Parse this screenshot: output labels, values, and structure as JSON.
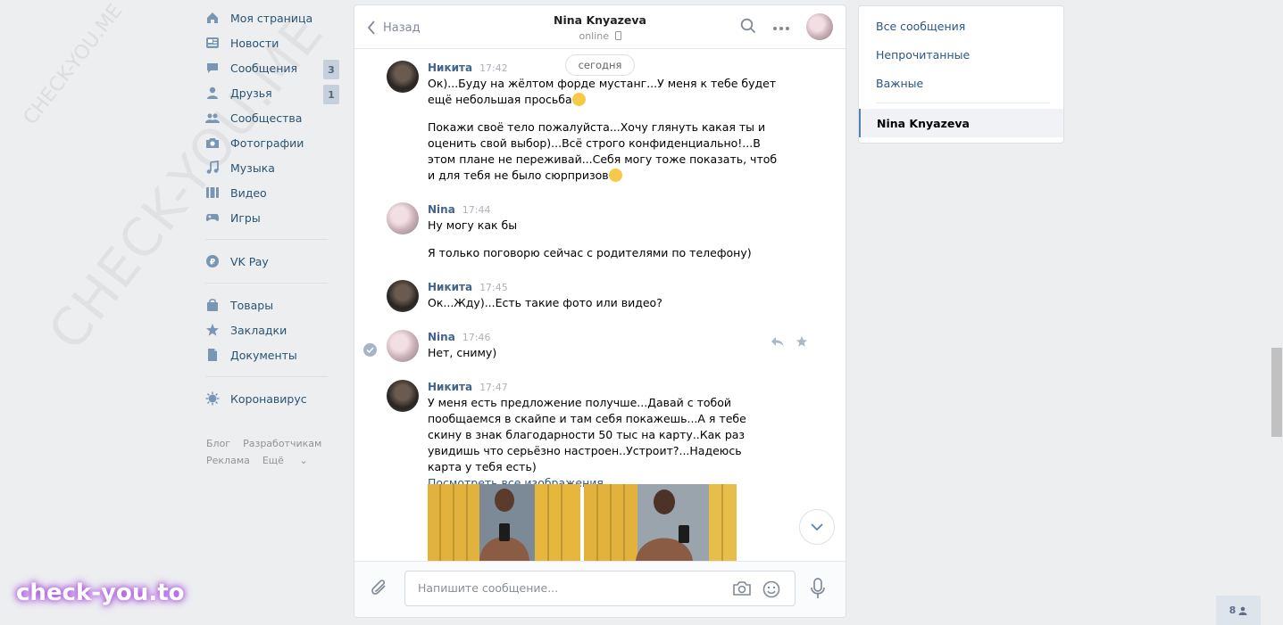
{
  "watermark": {
    "big": "CHECK-YOU.ME",
    "small": "CHECK-YOU.ME",
    "brand": "check-you.to"
  },
  "nav": {
    "items": [
      {
        "label": "Моя страница",
        "icon": "home-icon"
      },
      {
        "label": "Новости",
        "icon": "news-icon"
      },
      {
        "label": "Сообщения",
        "icon": "message-icon",
        "badge": "3"
      },
      {
        "label": "Друзья",
        "icon": "friends-icon",
        "badge": "1"
      },
      {
        "label": "Сообщества",
        "icon": "groups-icon"
      },
      {
        "label": "Фотографии",
        "icon": "camera-icon"
      },
      {
        "label": "Музыка",
        "icon": "music-icon"
      },
      {
        "label": "Видео",
        "icon": "video-icon"
      },
      {
        "label": "Игры",
        "icon": "gamepad-icon"
      }
    ],
    "vkpay": "VK Pay",
    "items2": [
      {
        "label": "Товары",
        "icon": "bag-icon"
      },
      {
        "label": "Закладки",
        "icon": "star-icon"
      },
      {
        "label": "Документы",
        "icon": "document-icon"
      }
    ],
    "corona": "Коронавирус",
    "footer": [
      "Блог",
      "Разработчикам",
      "Реклама",
      "Ещё"
    ]
  },
  "chat": {
    "back_label": "Назад",
    "title": "Nina Knyazeva",
    "status": "online",
    "date_pill": "сегодня",
    "messages": [
      {
        "name": "Никита",
        "time": "17:42",
        "texts": [
          "Ок)...Буду на жёлтом форде мустанг...У меня к тебе будет ещё небольшая просьба",
          "Покажи своё тело пожалуйста...Хочу глянуть какая ты и оценить свой выбор)...Всё строго конфиденциально!...В этом плане не переживай...Себя могу тоже показать, чтоб и для тебя не было сюрпризов"
        ]
      },
      {
        "name": "Nina",
        "time": "17:44",
        "texts": [
          "Ну могу как бы",
          "Я только поговорю сейчас с родителями по телефону)"
        ]
      },
      {
        "name": "Никита",
        "time": "17:45",
        "texts": [
          "Ок...Жду)...Есть такие фото или видео?"
        ]
      },
      {
        "name": "Nina",
        "time": "17:46",
        "texts": [
          "Нет, сниму)"
        ]
      },
      {
        "name": "Никита",
        "time": "17:47",
        "texts": [
          "У меня есть предложение получше...Давай с тобой пообщаемся в скайпе и там себя покажешь...А я тебе скину в знак благодарности 50 тыс на карту..Как раз увидишь что серьёзно настроен..Устроит?...Надеюсь карта у тебя есть)"
        ],
        "link": "Посмотреть все изображения"
      }
    ],
    "input_placeholder": "Напишите сообщение..."
  },
  "right_panel": {
    "items": [
      "Все сообщения",
      "Непрочитанные",
      "Важные"
    ],
    "active": "Nina Knyazeva"
  },
  "online_count": "8"
}
